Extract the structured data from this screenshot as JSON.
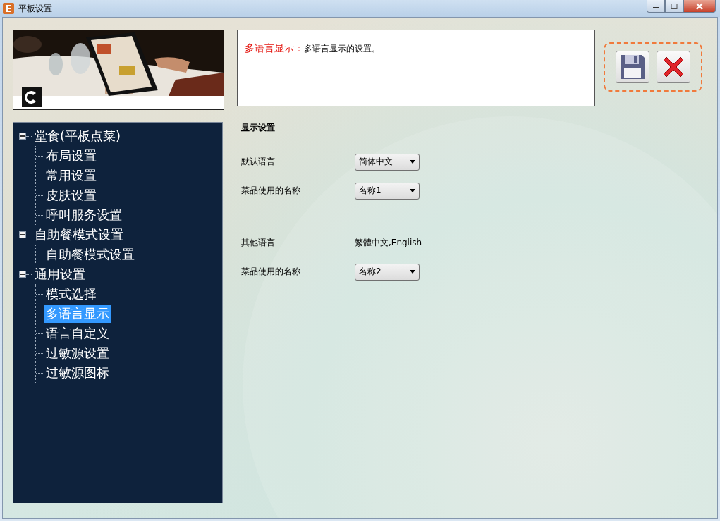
{
  "window": {
    "title": "平板设置"
  },
  "description": {
    "title": "多语言显示：",
    "text": "多语言显示的设置。"
  },
  "toolbar": [
    {
      "kind": "save"
    },
    {
      "kind": "cancel"
    }
  ],
  "tree": [
    {
      "label": "堂食(平板点菜)",
      "expanded": true,
      "selected": false,
      "children": [
        {
          "label": "布局设置",
          "selected": false
        },
        {
          "label": "常用设置",
          "selected": false
        },
        {
          "label": "皮肤设置",
          "selected": false
        },
        {
          "label": "呼叫服务设置",
          "selected": false
        }
      ]
    },
    {
      "label": "自助餐模式设置",
      "expanded": true,
      "selected": false,
      "children": [
        {
          "label": "自助餐模式设置",
          "selected": false
        }
      ]
    },
    {
      "label": "通用设置",
      "expanded": true,
      "selected": false,
      "children": [
        {
          "label": "模式选择",
          "selected": false
        },
        {
          "label": "多语言显示",
          "selected": true
        },
        {
          "label": "语言自定义",
          "selected": false
        },
        {
          "label": "过敏源设置",
          "selected": false
        },
        {
          "label": "过敏源图标",
          "selected": false
        }
      ]
    }
  ],
  "sections": [
    {
      "title": "显示设置",
      "fields": [
        {
          "label": "默认语言",
          "kind": "select",
          "value": "简体中文"
        },
        {
          "label": "菜品使用的名称",
          "kind": "select",
          "value": "名称1"
        }
      ]
    },
    {
      "fields": [
        {
          "label": "其他语言",
          "kind": "text",
          "value": "繁體中文,English"
        },
        {
          "label": "菜品使用的名称",
          "kind": "select",
          "value": "名称2"
        }
      ]
    }
  ]
}
